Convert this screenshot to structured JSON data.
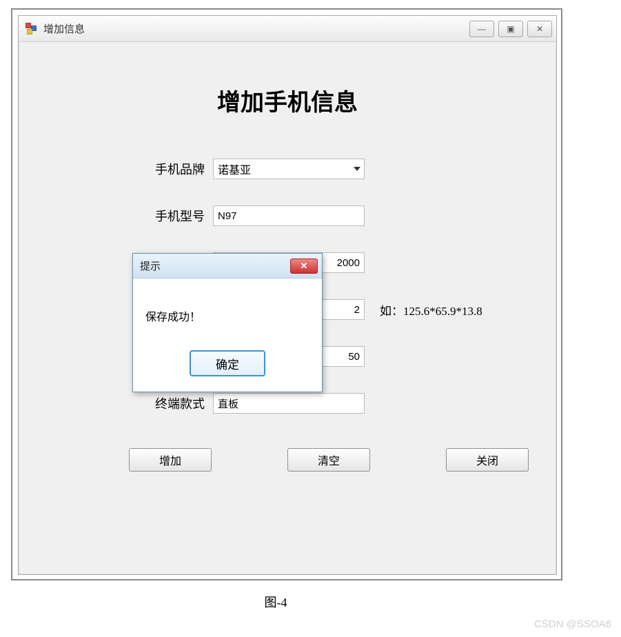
{
  "window": {
    "title": "增加信息",
    "min_glyph": "—",
    "max_glyph": "▣",
    "close_glyph": "✕"
  },
  "form": {
    "heading": "增加手机信息",
    "fields": {
      "brand": {
        "label": "手机品牌",
        "value": "诺基亚"
      },
      "model": {
        "label": "手机型号",
        "value": "N97"
      },
      "price": {
        "value": "2000"
      },
      "size": {
        "value": "2",
        "hint": "如：125.6*65.9*13.8"
      },
      "stock": {
        "value": "50"
      },
      "style": {
        "label": "终端款式",
        "value": "直板"
      }
    },
    "buttons": {
      "add": "增加",
      "clear": "清空",
      "close": "关闭"
    }
  },
  "dialog": {
    "title": "提示",
    "message": "保存成功！",
    "ok": "确定",
    "close_glyph": "✕"
  },
  "caption": "图-4",
  "watermark": "CSDN @SSOA6"
}
